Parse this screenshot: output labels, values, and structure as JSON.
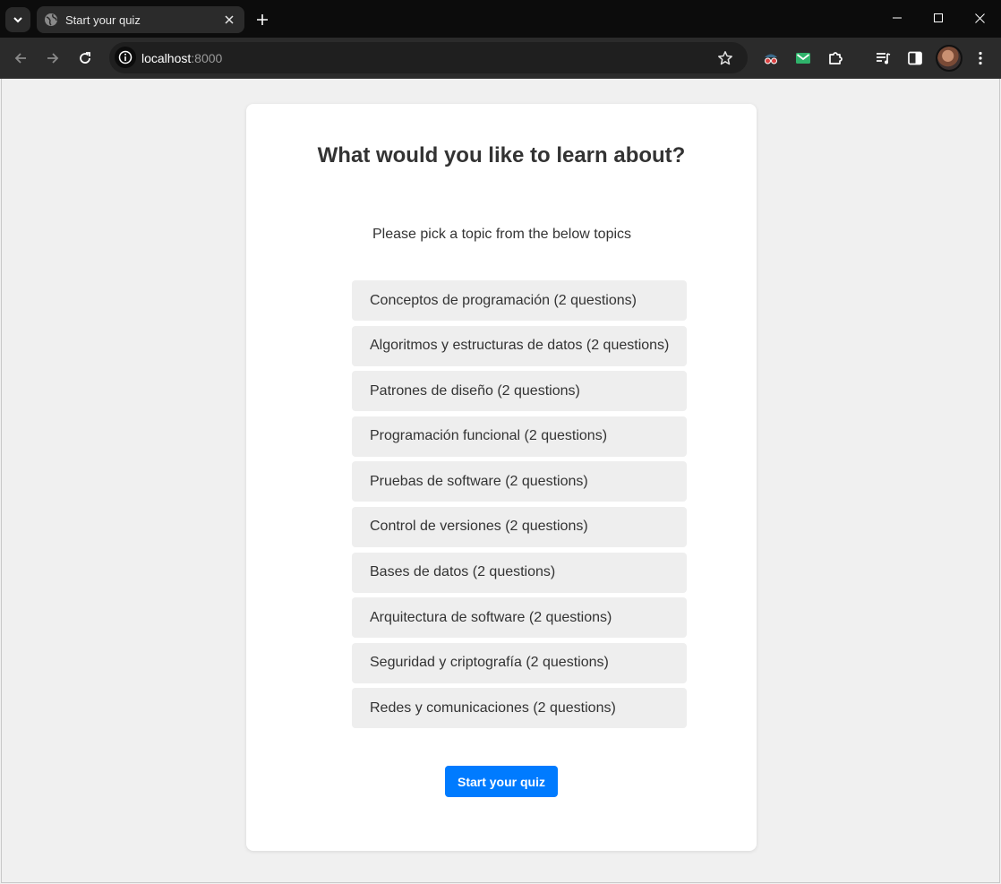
{
  "browser": {
    "tab_title": "Start your quiz",
    "url_host": "localhost",
    "url_port": ":8000"
  },
  "page": {
    "heading": "What would you like to learn about?",
    "subtitle": "Please pick a topic from the below topics",
    "topics": [
      {
        "label": "Conceptos de programación (2 questions)"
      },
      {
        "label": "Algoritmos y estructuras de datos (2 questions)"
      },
      {
        "label": "Patrones de diseño (2 questions)"
      },
      {
        "label": "Programación funcional (2 questions)"
      },
      {
        "label": "Pruebas de software (2 questions)"
      },
      {
        "label": "Control de versiones (2 questions)"
      },
      {
        "label": "Bases de datos (2 questions)"
      },
      {
        "label": "Arquitectura de software (2 questions)"
      },
      {
        "label": "Seguridad y criptografía (2 questions)"
      },
      {
        "label": "Redes y comunicaciones (2 questions)"
      }
    ],
    "start_button_label": "Start your quiz"
  },
  "colors": {
    "primary_button": "#007bff",
    "topic_background": "#eeeeee",
    "page_background": "#f0f0f0",
    "text": "#333333"
  },
  "icons": {
    "tab_search": "chevron-down-icon",
    "favicon": "globe-icon",
    "tab_close": "close-icon",
    "new_tab": "plus-icon",
    "back": "arrow-left-icon",
    "forward": "arrow-right-icon",
    "reload": "reload-icon",
    "site_info": "info-icon",
    "bookmark": "star-icon",
    "extensions": [
      "spy-extension-icon",
      "mail-extension-icon",
      "puzzle-icon",
      "media-control-icon",
      "side-panel-icon"
    ],
    "menu": "kebab-menu-icon"
  }
}
